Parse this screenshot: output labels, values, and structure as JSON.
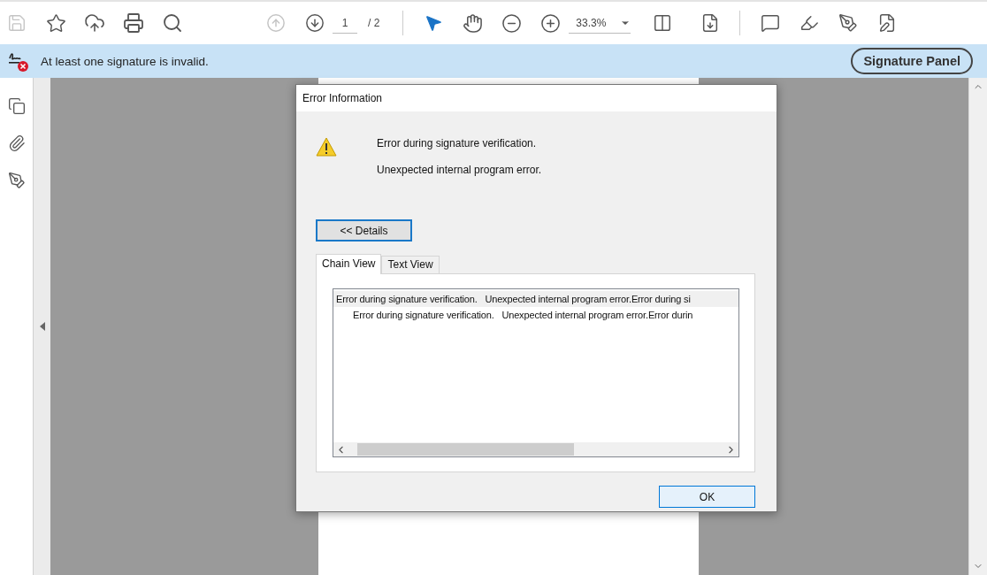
{
  "toolbar": {
    "save_button": {
      "disabled": true
    },
    "previous_page_button": {
      "disabled": true
    },
    "page_field": {
      "value": "1"
    },
    "page_total": "/ 2",
    "select_tool": {
      "selected": true
    },
    "zoom_field": {
      "value": "33.3%"
    }
  },
  "signature_bar": {
    "message": "At least one signature is invalid.",
    "button": "Signature Panel"
  },
  "dialog": {
    "title": "Error Information",
    "messages": [
      "Error during signature verification.",
      "Unexpected internal program error."
    ],
    "details_button": "<< Details",
    "tabs": [
      {
        "label": "Chain View",
        "selected": true
      },
      {
        "label": "Text View",
        "selected": false
      }
    ],
    "chain": [
      {
        "text": "Error during signature verification.   Unexpected internal program error.Error during si",
        "selected": true,
        "children": [
          {
            "text": "Error during signature verification.   Unexpected internal program error.Error durin",
            "selected": false
          }
        ]
      }
    ],
    "ok_button": "OK"
  }
}
